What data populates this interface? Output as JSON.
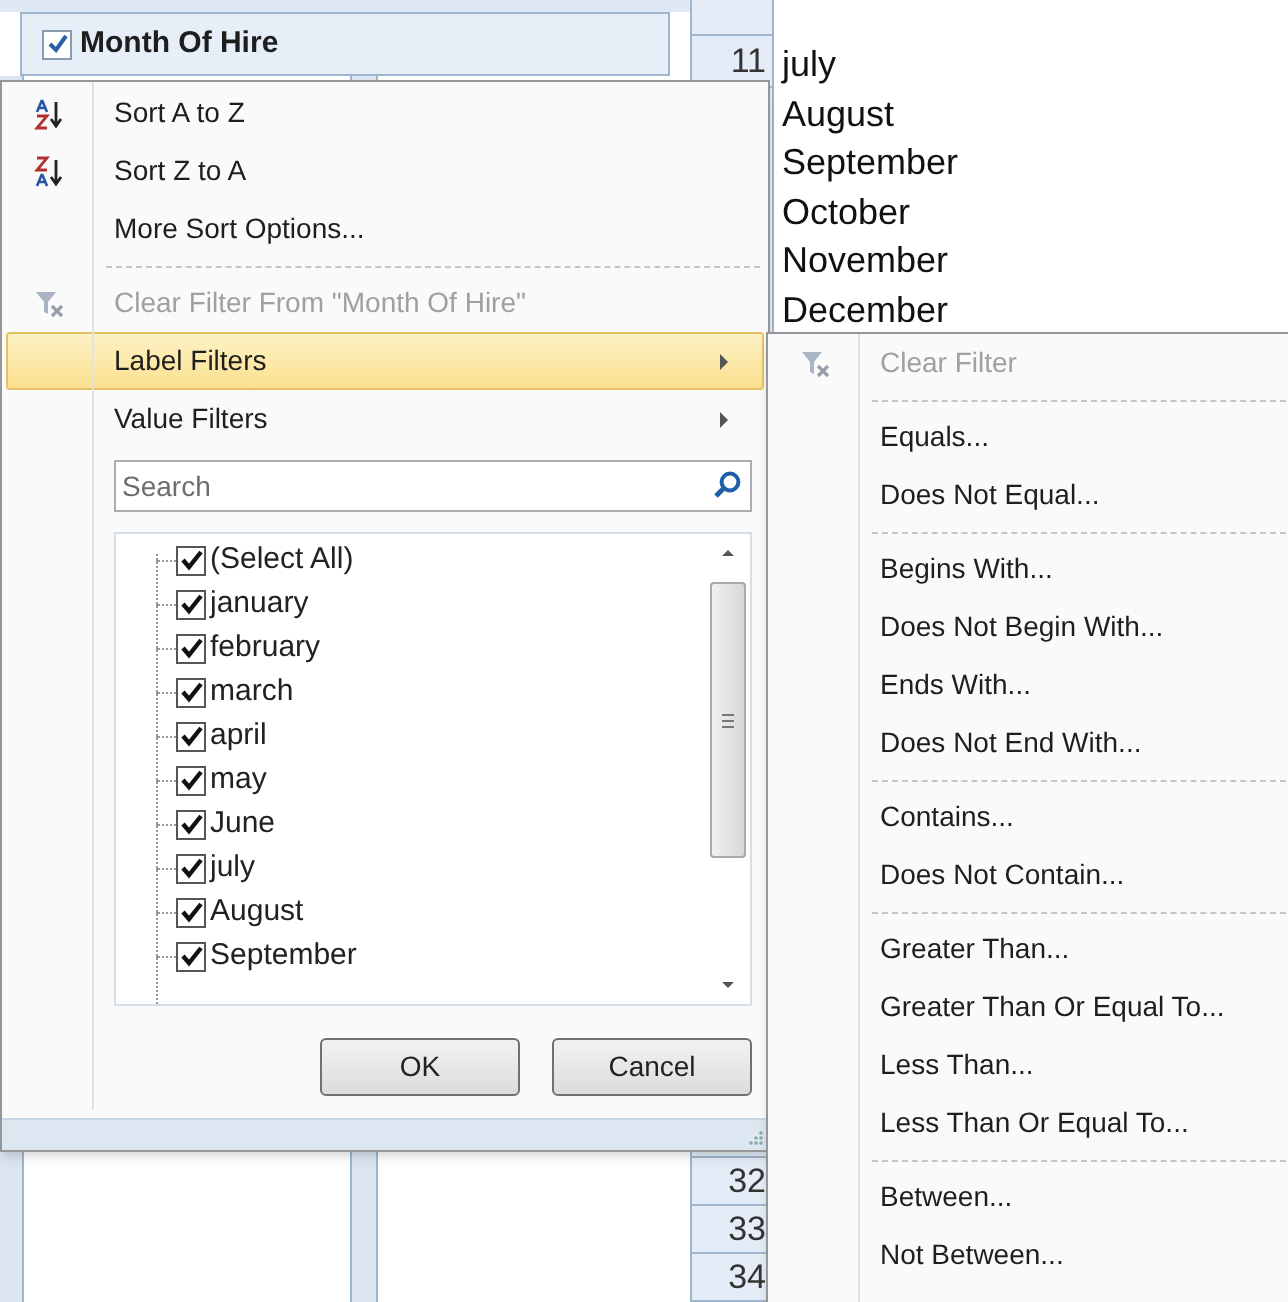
{
  "sheet": {
    "header_cell": {
      "label": "Month Of Hire",
      "checked": true
    },
    "top_row_numbers": [
      "11"
    ],
    "column_values": [
      "july",
      "August",
      "September",
      "October",
      "November",
      "December"
    ],
    "bottom_row_numbers": [
      "32",
      "33",
      "34"
    ]
  },
  "menu": {
    "items": [
      {
        "kind": "sort_ascending",
        "label": "Sort A to Z",
        "disabled": false,
        "highlighted": false
      },
      {
        "kind": "sort_descending",
        "label": "Sort Z to A",
        "disabled": false,
        "highlighted": false
      },
      {
        "kind": "command",
        "label": "More Sort Options...",
        "disabled": false,
        "highlighted": false
      },
      {
        "kind": "separator"
      },
      {
        "kind": "clear_filter",
        "label": "Clear Filter From \"Month Of Hire\"",
        "disabled": true,
        "highlighted": false
      },
      {
        "kind": "submenu",
        "label": "Label Filters",
        "disabled": false,
        "highlighted": true
      },
      {
        "kind": "submenu",
        "label": "Value Filters",
        "disabled": false,
        "highlighted": false
      }
    ],
    "search": {
      "placeholder": "Search"
    },
    "list": {
      "items": [
        {
          "label": "(Select All)",
          "checked": true
        },
        {
          "label": "january",
          "checked": true
        },
        {
          "label": "february",
          "checked": true
        },
        {
          "label": "march",
          "checked": true
        },
        {
          "label": "april",
          "checked": true
        },
        {
          "label": "may",
          "checked": true
        },
        {
          "label": "June",
          "checked": true
        },
        {
          "label": "july",
          "checked": true
        },
        {
          "label": "August",
          "checked": true
        },
        {
          "label": "September",
          "checked": true
        }
      ]
    },
    "buttons": [
      "OK",
      "Cancel"
    ]
  },
  "submenu": {
    "items": [
      {
        "kind": "clear_filter",
        "label": "Clear Filter",
        "disabled": true,
        "highlighted": false
      },
      {
        "kind": "separator"
      },
      {
        "kind": "command",
        "label": "Equals...",
        "disabled": false,
        "highlighted": false
      },
      {
        "kind": "command",
        "label": "Does Not Equal...",
        "disabled": false,
        "highlighted": false
      },
      {
        "kind": "separator"
      },
      {
        "kind": "command",
        "label": "Begins With...",
        "disabled": false,
        "highlighted": false
      },
      {
        "kind": "command",
        "label": "Does Not Begin With...",
        "disabled": false,
        "highlighted": false
      },
      {
        "kind": "command",
        "label": "Ends With...",
        "disabled": false,
        "highlighted": false
      },
      {
        "kind": "command",
        "label": "Does Not End With...",
        "disabled": false,
        "highlighted": false
      },
      {
        "kind": "separator"
      },
      {
        "kind": "command",
        "label": "Contains...",
        "disabled": false,
        "highlighted": false
      },
      {
        "kind": "command",
        "label": "Does Not Contain...",
        "disabled": false,
        "highlighted": false
      },
      {
        "kind": "separator"
      },
      {
        "kind": "command",
        "label": "Greater Than...",
        "disabled": false,
        "highlighted": false
      },
      {
        "kind": "command",
        "label": "Greater Than Or Equal To...",
        "disabled": false,
        "highlighted": false
      },
      {
        "kind": "command",
        "label": "Less Than...",
        "disabled": false,
        "highlighted": false
      },
      {
        "kind": "command",
        "label": "Less Than Or Equal To...",
        "disabled": false,
        "highlighted": false
      },
      {
        "kind": "separator"
      },
      {
        "kind": "command",
        "label": "Between...",
        "disabled": false,
        "highlighted": false
      },
      {
        "kind": "command",
        "label": "Not Between...",
        "disabled": false,
        "highlighted": false
      }
    ]
  }
}
